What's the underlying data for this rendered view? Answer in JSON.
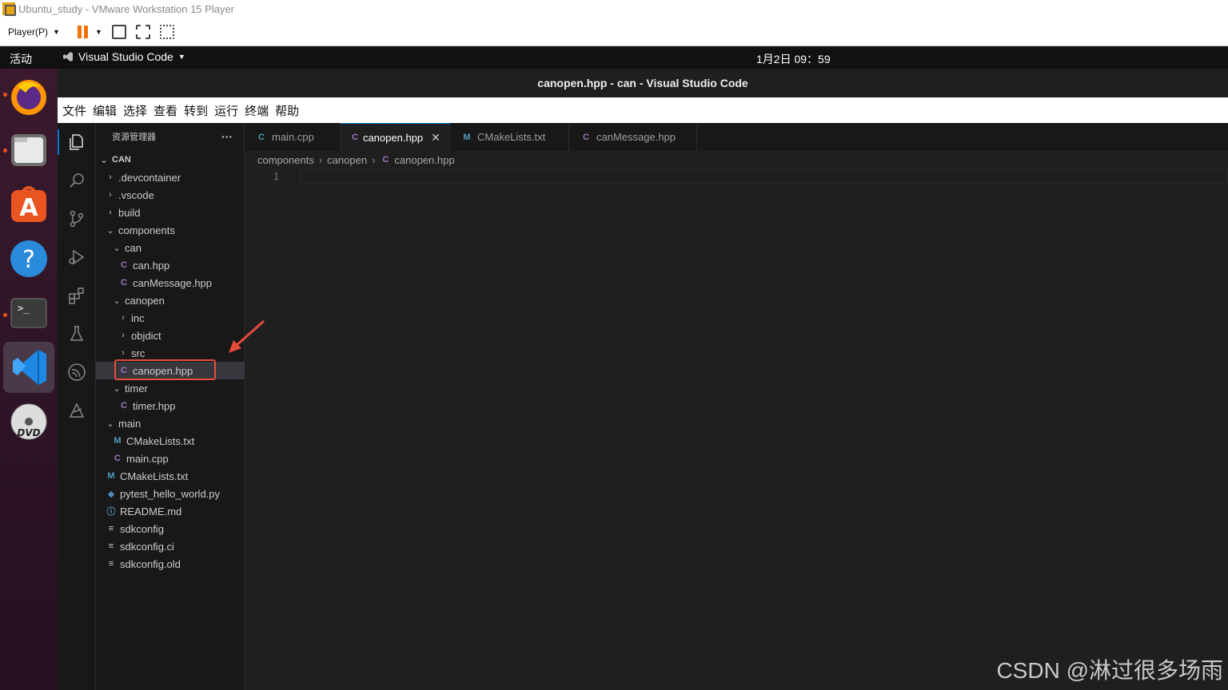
{
  "vm": {
    "title": "Ubuntu_study - VMware Workstation 15 Player",
    "player_menu": "Player(P)"
  },
  "gnome": {
    "activities": "活动",
    "app_name": "Visual Studio Code",
    "clock": "1月2日  09：59"
  },
  "dock": {
    "items": [
      "firefox",
      "files",
      "app-store",
      "help",
      "terminal",
      "vscode",
      "dvd"
    ]
  },
  "window": {
    "title": "canopen.hpp - can - Visual Studio Code"
  },
  "menu": [
    "文件",
    "编辑",
    "选择",
    "查看",
    "转到",
    "运行",
    "终端",
    "帮助"
  ],
  "explorer": {
    "title": "资源管理器",
    "more": "···",
    "root": "CAN",
    "items": [
      {
        "label": ".devcontainer",
        "type": "folder"
      },
      {
        "label": ".vscode",
        "type": "folder"
      },
      {
        "label": "build",
        "type": "folder"
      },
      {
        "label": "components",
        "type": "folder-open"
      },
      {
        "label": "can",
        "type": "folder-open"
      },
      {
        "label": "can.hpp",
        "type": "cpp"
      },
      {
        "label": "canMessage.hpp",
        "type": "cpp"
      },
      {
        "label": "canopen",
        "type": "folder-open"
      },
      {
        "label": "inc",
        "type": "folder"
      },
      {
        "label": "objdict",
        "type": "folder"
      },
      {
        "label": "src",
        "type": "folder"
      },
      {
        "label": "canopen.hpp",
        "type": "cpp",
        "selected": true
      },
      {
        "label": "timer",
        "type": "folder-open"
      },
      {
        "label": "timer.hpp",
        "type": "cpp"
      },
      {
        "label": "main",
        "type": "folder-open"
      },
      {
        "label": "CMakeLists.txt",
        "type": "cmake"
      },
      {
        "label": "main.cpp",
        "type": "cpp"
      },
      {
        "label": "CMakeLists.txt",
        "type": "cmake"
      },
      {
        "label": "pytest_hello_world.py",
        "type": "python"
      },
      {
        "label": "README.md",
        "type": "info"
      },
      {
        "label": "sdkconfig",
        "type": "text"
      },
      {
        "label": "sdkconfig.ci",
        "type": "text"
      },
      {
        "label": "sdkconfig.old",
        "type": "text"
      }
    ]
  },
  "tabs": [
    {
      "label": "main.cpp",
      "type": "cpp"
    },
    {
      "label": "canopen.hpp",
      "type": "cpp",
      "active": true
    },
    {
      "label": "CMakeLists.txt",
      "type": "cmake"
    },
    {
      "label": "canMessage.hpp",
      "type": "cpp"
    }
  ],
  "breadcrumb": [
    "components",
    "canopen",
    "canopen.hpp"
  ],
  "editor": {
    "line_number": "1"
  },
  "watermark": "CSDN @淋过很多场雨",
  "colors": {
    "accent": "#0078d4",
    "annotation": "#e84a3c",
    "ubuntu_orange": "#e95420"
  }
}
